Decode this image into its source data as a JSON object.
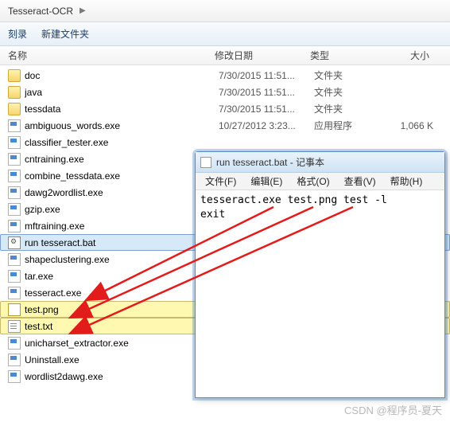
{
  "breadcrumb": {
    "item": "Tesseract-OCR"
  },
  "toolbar": {
    "burn": "刻录",
    "newFolder": "新建文件夹"
  },
  "columns": {
    "name": "名称",
    "date": "修改日期",
    "type": "类型",
    "size": "大小"
  },
  "files": [
    {
      "name": "doc",
      "icon": "folder",
      "date": "7/30/2015 11:51...",
      "type": "文件夹",
      "size": ""
    },
    {
      "name": "java",
      "icon": "folder",
      "date": "7/30/2015 11:51...",
      "type": "文件夹",
      "size": ""
    },
    {
      "name": "tessdata",
      "icon": "folder",
      "date": "7/30/2015 11:51...",
      "type": "文件夹",
      "size": ""
    },
    {
      "name": "ambiguous_words.exe",
      "icon": "exe",
      "date": "10/27/2012 3:23...",
      "type": "应用程序",
      "size": "1,066 K"
    },
    {
      "name": "classifier_tester.exe",
      "icon": "exe",
      "date": "",
      "type": "",
      "size": ""
    },
    {
      "name": "cntraining.exe",
      "icon": "exe",
      "date": "",
      "type": "",
      "size": ""
    },
    {
      "name": "combine_tessdata.exe",
      "icon": "exe",
      "date": "",
      "type": "",
      "size": ""
    },
    {
      "name": "dawg2wordlist.exe",
      "icon": "exe",
      "date": "",
      "type": "",
      "size": ""
    },
    {
      "name": "gzip.exe",
      "icon": "exe",
      "date": "",
      "type": "",
      "size": ""
    },
    {
      "name": "mftraining.exe",
      "icon": "exe",
      "date": "",
      "type": "",
      "size": ""
    },
    {
      "name": "run tesseract.bat",
      "icon": "bat",
      "date": "",
      "type": "",
      "size": "",
      "selected": true
    },
    {
      "name": "shapeclustering.exe",
      "icon": "exe",
      "date": "",
      "type": "",
      "size": ""
    },
    {
      "name": "tar.exe",
      "icon": "exe",
      "date": "",
      "type": "",
      "size": ""
    },
    {
      "name": "tesseract.exe",
      "icon": "exe",
      "date": "",
      "type": "",
      "size": ""
    },
    {
      "name": "test.png",
      "icon": "png",
      "date": "",
      "type": "",
      "size": "",
      "highlight": true
    },
    {
      "name": "test.txt",
      "icon": "txt",
      "date": "",
      "type": "",
      "size": "",
      "highlight": true
    },
    {
      "name": "unicharset_extractor.exe",
      "icon": "exe",
      "date": "",
      "type": "",
      "size": ""
    },
    {
      "name": "Uninstall.exe",
      "icon": "exe",
      "date": "",
      "type": "",
      "size": ""
    },
    {
      "name": "wordlist2dawg.exe",
      "icon": "exe",
      "date": "",
      "type": "",
      "size": ""
    }
  ],
  "notepad": {
    "title": "run tesseract.bat - 记事本",
    "menu": {
      "file": "文件(F)",
      "edit": "编辑(E)",
      "format": "格式(O)",
      "view": "查看(V)",
      "help": "帮助(H)"
    },
    "content": "tesseract.exe test.png test -l\nexit"
  },
  "watermark": "CSDN @程序员-夏天"
}
